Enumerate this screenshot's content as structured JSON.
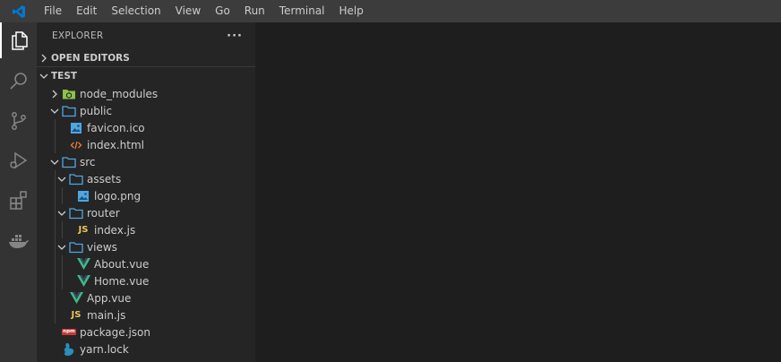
{
  "menu": {
    "items": [
      "File",
      "Edit",
      "Selection",
      "View",
      "Go",
      "Run",
      "Terminal",
      "Help"
    ]
  },
  "activity_bar": {
    "icons": [
      "files-icon",
      "search-icon",
      "source-control-icon",
      "run-debug-icon",
      "extensions-icon",
      "docker-icon"
    ]
  },
  "sidebar": {
    "title": "EXPLORER",
    "more": "···",
    "open_editors": "OPEN EDITORS",
    "folder": "TEST"
  },
  "tree": [
    {
      "label": "node_modules",
      "depth": 0,
      "kind": "folder-node",
      "open": false
    },
    {
      "label": "public",
      "depth": 0,
      "kind": "folder",
      "open": true
    },
    {
      "label": "favicon.ico",
      "depth": 1,
      "kind": "image"
    },
    {
      "label": "index.html",
      "depth": 1,
      "kind": "html"
    },
    {
      "label": "src",
      "depth": 0,
      "kind": "folder",
      "open": true
    },
    {
      "label": "assets",
      "depth": 1,
      "kind": "folder",
      "open": true
    },
    {
      "label": "logo.png",
      "depth": 2,
      "kind": "image"
    },
    {
      "label": "router",
      "depth": 1,
      "kind": "folder",
      "open": true
    },
    {
      "label": "index.js",
      "depth": 2,
      "kind": "js"
    },
    {
      "label": "views",
      "depth": 1,
      "kind": "folder",
      "open": true
    },
    {
      "label": "About.vue",
      "depth": 2,
      "kind": "vue"
    },
    {
      "label": "Home.vue",
      "depth": 2,
      "kind": "vue"
    },
    {
      "label": "App.vue",
      "depth": 1,
      "kind": "vue"
    },
    {
      "label": "main.js",
      "depth": 1,
      "kind": "js"
    },
    {
      "label": "package.json",
      "depth": 0,
      "kind": "npm"
    },
    {
      "label": "yarn.lock",
      "depth": 0,
      "kind": "yarn"
    }
  ],
  "icon_text": {
    "js": "JS",
    "npm": "npm"
  },
  "colors": {
    "titlebar": "#3c3c3c",
    "activitybar": "#333333",
    "sidebar": "#252526",
    "editor": "#1e1e1e",
    "vscode_blue": "#0078d4",
    "folder": "#4fa6e0",
    "vue": "#41b883",
    "js": "#e8c75a",
    "html": "#e37933"
  }
}
